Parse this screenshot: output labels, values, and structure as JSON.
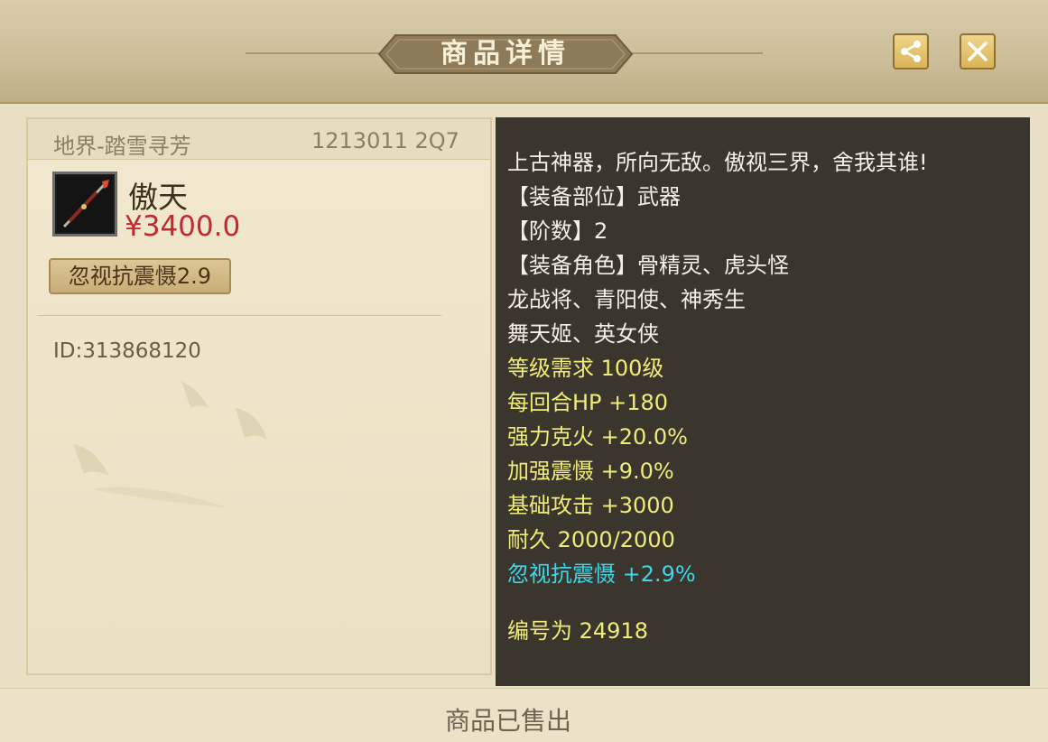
{
  "header": {
    "title": "商品详情",
    "share_icon": "share-icon",
    "close_icon": "close-icon"
  },
  "listing": {
    "server": "地界-踏雪寻芳",
    "seller_code": "1213011 2Q7",
    "item_name": "傲天",
    "price": "¥3400.0",
    "attribute_tag": "忽视抗震慑2.9",
    "item_id": "ID:313868120",
    "item_icon": "spear-weapon-icon"
  },
  "description": {
    "lines": [
      "上古神器，所向无敌。傲视三界，舍我其谁!",
      "【装备部位】武器",
      "【阶数】2",
      "【装备角色】骨精灵、虎头怪",
      "龙战将、青阳使、神秀生",
      "舞天姬、英女侠",
      "等级需求 100级",
      "每回合HP +180",
      "强力克火 +20.0%",
      "加强震慑 +9.0%",
      "基础攻击 +3000",
      "耐久 2000/2000",
      "忽视抗震慑 +2.9%",
      "编号为 24918"
    ]
  },
  "footer": {
    "status": "商品已售出"
  },
  "colors": {
    "price": "#c3282e",
    "stat_yellow": "#f0ec7a",
    "special_cyan": "#3ed6e8",
    "panel_dark": "#3a352d"
  }
}
